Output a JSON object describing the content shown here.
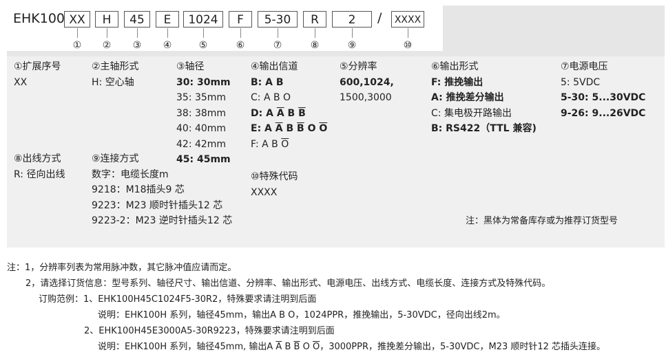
{
  "model": {
    "prefix": "EHK100",
    "separator": "/",
    "codes": [
      "XX",
      "H",
      "45",
      "E",
      "1024",
      "F",
      "5-30",
      "R",
      "2",
      "XXXX"
    ],
    "markers": [
      "①",
      "②",
      "③",
      "④",
      "⑤",
      "⑥",
      "⑦",
      "⑧",
      "⑨",
      "⑩"
    ]
  },
  "sections": {
    "serial": {
      "title": "①扩展序号",
      "value": "XX"
    },
    "spindle": {
      "title": "②主轴形式",
      "value": "H: 空心轴"
    },
    "shaft": {
      "title": "③轴径",
      "rows": [
        {
          "code": "30:",
          "val": "30mm",
          "bold": true
        },
        {
          "code": "35:",
          "val": "35mm",
          "bold": false
        },
        {
          "code": "38:",
          "val": "38mm",
          "bold": false
        },
        {
          "code": "40:",
          "val": "40mm",
          "bold": false
        },
        {
          "code": "42:",
          "val": "42mm",
          "bold": false
        },
        {
          "code": "45:",
          "val": "45mm",
          "bold": true
        }
      ]
    },
    "channel": {
      "title": "④输出信道",
      "rows": [
        {
          "code": "B:",
          "bold": true,
          "sig": [
            [
              "A",
              false
            ],
            [
              "B",
              false
            ]
          ]
        },
        {
          "code": "C:",
          "bold": false,
          "sig": [
            [
              "A",
              false
            ],
            [
              "B",
              false
            ],
            [
              "O",
              false
            ]
          ]
        },
        {
          "code": "D:",
          "bold": true,
          "sig": [
            [
              "A",
              false
            ],
            [
              "A",
              true
            ],
            [
              "B",
              false
            ],
            [
              "B",
              true
            ]
          ]
        },
        {
          "code": "E:",
          "bold": true,
          "sig": [
            [
              "A",
              false
            ],
            [
              "A",
              true
            ],
            [
              "B",
              false
            ],
            [
              "B",
              true
            ],
            [
              "O",
              false
            ],
            [
              "O",
              true
            ]
          ]
        },
        {
          "code": "F:",
          "bold": false,
          "sig": [
            [
              "A",
              false
            ],
            [
              "B",
              false
            ],
            [
              "O",
              true
            ]
          ]
        }
      ]
    },
    "resolution": {
      "title": "⑤分辨率",
      "line1": "600,1024,",
      "line2": "1500,3000"
    },
    "output": {
      "title": "⑥输出形式",
      "rows": [
        {
          "code": "F:",
          "val": "推挽输出",
          "bold": true
        },
        {
          "code": "A:",
          "val": "推挽差分输出",
          "bold": true
        },
        {
          "code": "C:",
          "val": "集电极开路输出",
          "bold": false
        },
        {
          "code": "B:",
          "val": "RS422（TTL 兼容)",
          "bold": true
        }
      ]
    },
    "voltage": {
      "title": "⑦电源电压",
      "rows": [
        {
          "code": "5:",
          "val": "5VDC",
          "bold": false
        },
        {
          "code": "5-30:",
          "val": "5...30VDC",
          "bold": true
        },
        {
          "code": "9-26:",
          "val": "9...26VDC",
          "bold": true
        }
      ]
    },
    "cable": {
      "title": "⑧出线方式",
      "value": "R: 径向出线"
    },
    "connection": {
      "title": "⑨连接方式",
      "rows": [
        "数字：电缆长度m",
        "9218：M18插头9 芯",
        "9223：M23 顺时针插头12 芯",
        "9223-2：M23 逆时针插头12 芯"
      ]
    },
    "special": {
      "title": "⑩特殊代码",
      "value": "XXXX"
    },
    "remark": "注：黑体为常备库存或为推荐订货型号"
  },
  "notes": {
    "n1": "注：1，分辨率列表为常用脉冲数，其它脉冲值应请而定。",
    "n2": "2，请选择订货信息：型号系列、轴径尺寸、输出信道、分辨率、输出形式、电源电压、出线方式、电缆长度、连接方式及特殊代码。",
    "ex1": "订购范例：1、EHK100H45C1024F5-30R2，特殊要求请注明到后面",
    "ex1_desc": "说明：EHK100H 系列，轴径45mm，输出A B O，1024PPR，推挽输出，5-30VDC，径向出线2m。",
    "ex2": "2、EHK100H45E3000A5-30R9223，特殊要求请注明到后面",
    "ex2_desc_pre": "说明：EHK100H 系列，轴径45mm, 输出",
    "ex2_sig": [
      [
        "A",
        false
      ],
      [
        "A",
        true
      ],
      [
        "B",
        false
      ],
      [
        "B",
        true
      ],
      [
        "O",
        false
      ],
      [
        "O",
        true
      ]
    ],
    "ex2_desc_post": "，3000PPR，推挽差分输出，5-30VDC，M23 顺时针12 芯插头连接。"
  }
}
